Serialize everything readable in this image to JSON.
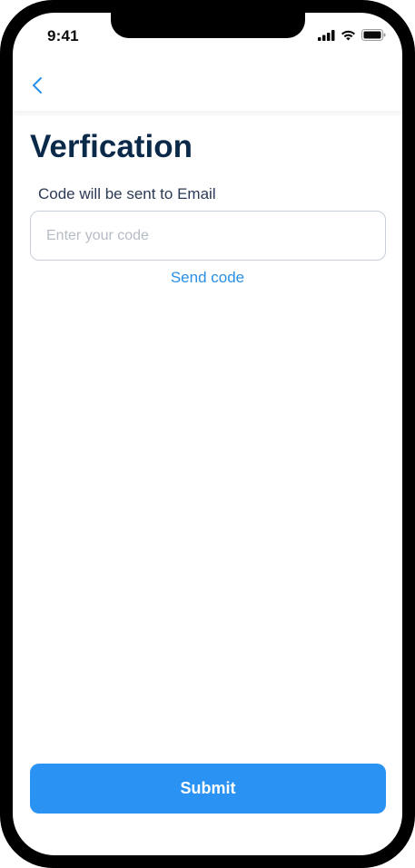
{
  "status_bar": {
    "time": "9:41",
    "icons": [
      "cellular-signal-icon",
      "wifi-icon",
      "battery-icon"
    ]
  },
  "nav": {
    "back_icon": "chevron-left-icon"
  },
  "header": {
    "title": "Verfication"
  },
  "form": {
    "subtitle": "Code will be sent to Email",
    "code_input": {
      "placeholder": "Enter your code",
      "value": ""
    },
    "send_code_label": "Send code",
    "submit_label": "Submit"
  },
  "colors": {
    "accent": "#2a92f3",
    "link": "#2a8fe6",
    "title": "#0b2a4a",
    "frame": "#000000"
  }
}
